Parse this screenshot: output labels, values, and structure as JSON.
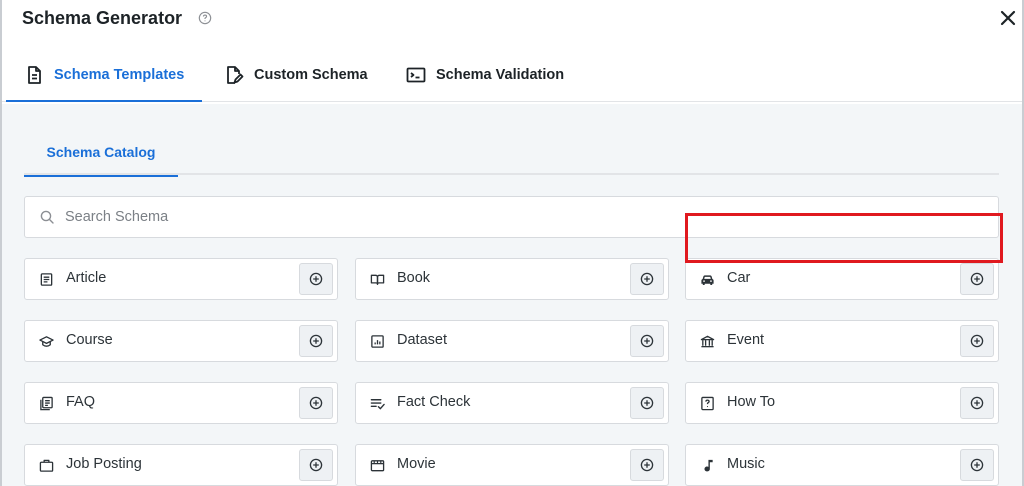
{
  "header": {
    "title": "Schema Generator"
  },
  "tabs": [
    {
      "label": "Schema Templates",
      "icon": "document-icon",
      "active": true
    },
    {
      "label": "Custom Schema",
      "icon": "document-edit-icon",
      "active": false
    },
    {
      "label": "Schema Validation",
      "icon": "terminal-icon",
      "active": false
    }
  ],
  "catalog": {
    "subtab_label": "Schema Catalog",
    "search_placeholder": "Search Schema",
    "search_value": ""
  },
  "schemas": [
    {
      "label": "Article",
      "icon": "article-icon"
    },
    {
      "label": "Book",
      "icon": "book-icon"
    },
    {
      "label": "Car",
      "icon": "car-icon"
    },
    {
      "label": "Course",
      "icon": "graduation-cap-icon"
    },
    {
      "label": "Dataset",
      "icon": "dataset-icon"
    },
    {
      "label": "Event",
      "icon": "event-building-icon",
      "highlighted": true
    },
    {
      "label": "FAQ",
      "icon": "faq-icon"
    },
    {
      "label": "Fact Check",
      "icon": "fact-check-icon"
    },
    {
      "label": "How To",
      "icon": "question-box-icon"
    },
    {
      "label": "Job Posting",
      "icon": "briefcase-icon"
    },
    {
      "label": "Movie",
      "icon": "film-icon"
    },
    {
      "label": "Music",
      "icon": "music-note-icon"
    }
  ],
  "colors": {
    "accent": "#1a6fd8",
    "highlight": "#e0191f",
    "panel_background": "#f3f6f8"
  }
}
